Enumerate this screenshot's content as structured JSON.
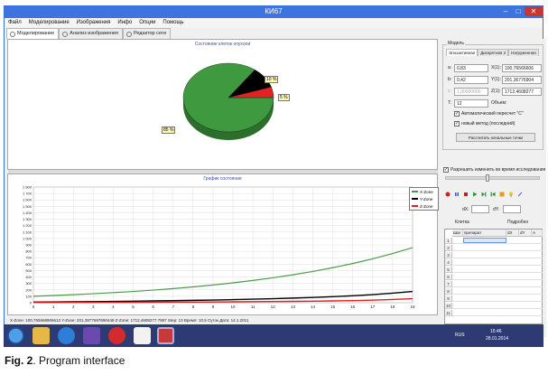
{
  "window": {
    "title": "КИ67",
    "minimize": "–",
    "maximize": "□",
    "close": "✕"
  },
  "menu": [
    "Файл",
    "Моделирование",
    "Изображения",
    "Инфо",
    "Опции",
    "Помощь"
  ],
  "tabs": [
    "Моделирование",
    "Анализ изображения",
    "Редактор сеги"
  ],
  "pie": {
    "title": "Состояние клеток опухоли",
    "labels": [
      "85 %",
      "10 %",
      "5 %"
    ]
  },
  "chart_data": {
    "type": "line",
    "title": "График состояния",
    "xlabel": "",
    "ylabel": "",
    "xlim": [
      0,
      19
    ],
    "ylim": [
      0,
      1800
    ],
    "x_ticks": [
      "0",
      "1",
      "2",
      "3",
      "4",
      "5",
      "6",
      "7",
      "8",
      "9",
      "10",
      "11",
      "12",
      "13",
      "14",
      "15",
      "16",
      "17",
      "18",
      "19"
    ],
    "y_ticks": [
      "0",
      "100",
      "200",
      "300",
      "400",
      "500",
      "600",
      "700",
      "800",
      "900",
      "1 000",
      "1 100",
      "1 200",
      "1 300",
      "1 400",
      "1 500",
      "1 600",
      "1 700",
      "1 800"
    ],
    "x": [
      0,
      1,
      2,
      3,
      4,
      5,
      6,
      7,
      8,
      9,
      10,
      11,
      12,
      13,
      14,
      15,
      16,
      17,
      18,
      19
    ],
    "series": [
      {
        "name": "X-Zone",
        "color": "#4a9c4a",
        "values": [
          100,
          112,
          125,
          140,
          157,
          175,
          196,
          220,
          246,
          276,
          309,
          346,
          388,
          434,
          486,
          545,
          610,
          683,
          765,
          857
        ]
      },
      {
        "name": "Y-Zone",
        "color": "#000000",
        "values": [
          10,
          12,
          14,
          17,
          20,
          24,
          28,
          32,
          37,
          42,
          48,
          55,
          63,
          72,
          82,
          94,
          108,
          125,
          148,
          175
        ]
      },
      {
        "name": "Z-Zone",
        "color": "#e02020",
        "values": [
          2,
          3,
          4,
          5,
          6,
          7,
          8,
          9,
          10,
          12,
          14,
          16,
          18,
          21,
          24,
          28,
          33,
          40,
          50,
          62
        ]
      }
    ],
    "legend": "top-right",
    "grid": true
  },
  "pie_data": {
    "type": "pie",
    "values": [
      85,
      10,
      5
    ],
    "colors": [
      "#3f9a3f",
      "#000000",
      "#e32222"
    ]
  },
  "rpanel": {
    "group_model": "Модель",
    "subtabs": [
      "Эпохактивная",
      "Дискретная 2",
      "Нагруженная"
    ],
    "fields": [
      {
        "label": "a:",
        "value": "0,83",
        "rlabel": "X(1):",
        "rvalue": "100,76566606"
      },
      {
        "label": "b:",
        "value": "0,42",
        "rlabel": "Y(1):",
        "rvalue": "201,36776904"
      },
      {
        "label": "c:",
        "value": "1,00000000",
        "rlabel": "Z(1):",
        "rvalue": "1712,4608277"
      },
      {
        "label": "T:",
        "value": "12",
        "rlabel": "Объем:",
        "rvalue": ""
      }
    ],
    "check_auto": "Автоматический пересчет \"C\"",
    "check_new": "новый метод (последний)",
    "btn_reset": "Рассчитать начальные точки",
    "check_switch": "Разрешить изменить во время исследования",
    "small_label_1": "dX:",
    "small_label_2": "dY:",
    "group_table": "Клетка",
    "group_table_r": "Подробно",
    "table_headers": [
      "Шаг",
      "препарат",
      "dX",
      "dY",
      "A"
    ],
    "table_rows": [
      "1",
      "2",
      "3",
      "4",
      "5",
      "6",
      "7",
      "8",
      "9",
      "10",
      "11"
    ]
  },
  "status": "X-Zone: 100,765668906613   Y-Zone: 201,3877697690448   Z-Zone: 1712,4608277 7997   Step: 13   Время: 10,5 Суток   Дата: 14.1.2011",
  "taskbar": {
    "lang": "RUS",
    "time": "15:46",
    "date": "28.01.2014"
  },
  "caption": {
    "fig": "Fig. 2",
    "text": ". Program interface"
  }
}
